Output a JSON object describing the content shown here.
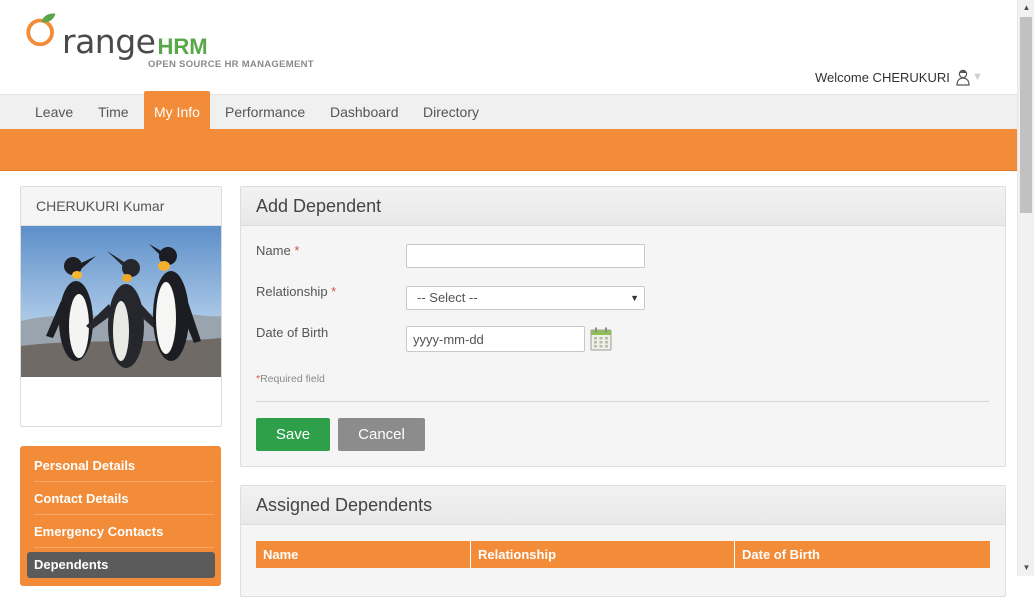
{
  "header": {
    "logo_word": "range",
    "logo_hrm": "HRM",
    "logo_tagline": "OPEN SOURCE HR MANAGEMENT",
    "welcome": "Welcome CHERUKURI",
    "icons": {
      "user": "user-icon",
      "caret": "chevron-down-icon"
    }
  },
  "nav": {
    "items": [
      "Leave",
      "Time",
      "My Info",
      "Performance",
      "Dashboard",
      "Directory"
    ],
    "active": "My Info"
  },
  "profile": {
    "name": "CHERUKURI Kumar",
    "photo": "penguins-photo"
  },
  "sidemenu": {
    "items": [
      "Personal Details",
      "Contact Details",
      "Emergency Contacts",
      "Dependents"
    ],
    "active": "Dependents"
  },
  "add_dependent": {
    "title": "Add Dependent",
    "fields": {
      "name": {
        "label": "Name",
        "required_mark": "*",
        "value": ""
      },
      "relationship": {
        "label": "Relationship",
        "required_mark": "*",
        "selected": "-- Select --"
      },
      "dob": {
        "label": "Date of Birth",
        "value": "yyyy-mm-dd"
      }
    },
    "required_note_mark": "*",
    "required_note": "Required field",
    "save": "Save",
    "cancel": "Cancel"
  },
  "assigned": {
    "title": "Assigned Dependents",
    "columns": [
      "Name",
      "Relationship",
      "Date of Birth"
    ]
  },
  "colors": {
    "brand_orange": "#f28c38",
    "save_green": "#2ea04a",
    "cancel_grey": "#8c8c8c",
    "active_side": "#5b5b5b",
    "logo_green": "#58a84a"
  }
}
